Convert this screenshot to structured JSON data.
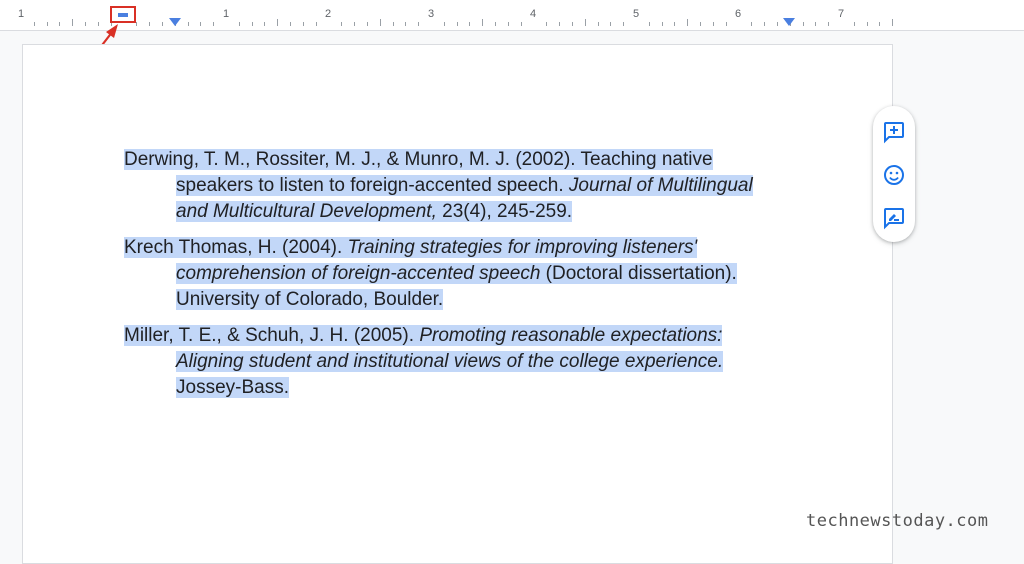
{
  "ruler": {
    "numbers": [
      "1",
      "1",
      "2",
      "3",
      "4",
      "5",
      "6",
      "7"
    ]
  },
  "references": [
    {
      "lines": [
        [
          {
            "t": "Derwing, T. M., Rossiter, M. J., & Munro, M. J. (2002). Teaching native",
            "i": false
          }
        ],
        [
          {
            "t": "speakers to listen to foreign-accented speech. ",
            "i": false
          },
          {
            "t": "Journal of Multilingual",
            "i": true
          }
        ],
        [
          {
            "t": "and Multicultural Development,",
            "i": true
          },
          {
            "t": " 23(4), 245-259.",
            "i": false
          }
        ]
      ]
    },
    {
      "lines": [
        [
          {
            "t": "Krech Thomas, H. (2004). ",
            "i": false
          },
          {
            "t": "Training strategies for improving listeners'",
            "i": true
          }
        ],
        [
          {
            "t": "comprehension of foreign-accented speech",
            "i": true
          },
          {
            "t": " (Doctoral dissertation).",
            "i": false
          }
        ],
        [
          {
            "t": "University of Colorado, Boulder.",
            "i": false
          }
        ]
      ]
    },
    {
      "lines": [
        [
          {
            "t": "Miller, T. E., & Schuh, J. H. (2005). ",
            "i": false
          },
          {
            "t": "Promoting reasonable expectations:",
            "i": true
          }
        ],
        [
          {
            "t": "Aligning student and institutional views of the college experience.",
            "i": true
          }
        ],
        [
          {
            "t": "Jossey-Bass.",
            "i": false
          }
        ]
      ]
    }
  ],
  "side_panel": {
    "icons": [
      "add-comment-icon",
      "emoji-icon",
      "suggest-edit-icon"
    ]
  },
  "watermark": "technewstoday.com",
  "colors": {
    "selection": "#c2d7f8",
    "accent": "#1a73e8",
    "marker_highlight": "#d93025"
  }
}
